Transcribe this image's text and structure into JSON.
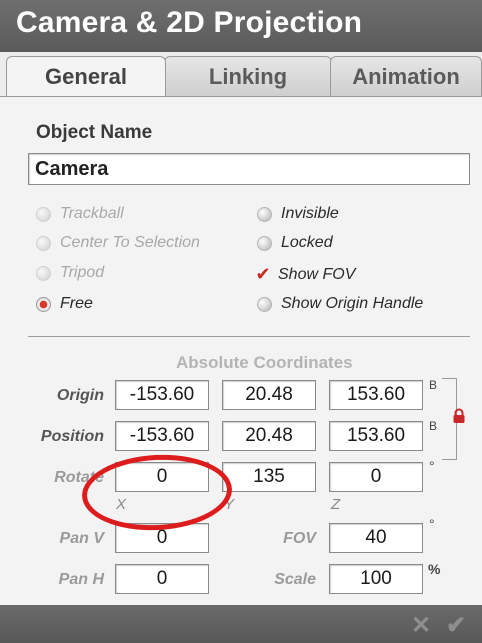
{
  "window": {
    "title": "Camera & 2D Projection"
  },
  "tabs": [
    {
      "label": "General",
      "active": true
    },
    {
      "label": "Linking",
      "active": false
    },
    {
      "label": "Animation",
      "active": false
    }
  ],
  "object_name": {
    "label": "Object Name",
    "value": "Camera"
  },
  "options": {
    "camera_modes": [
      {
        "label": "Trackball",
        "selected": false,
        "enabled": false
      },
      {
        "label": "Center To Selection",
        "selected": false,
        "enabled": false
      },
      {
        "label": "Tripod",
        "selected": false,
        "enabled": false
      },
      {
        "label": "Free",
        "selected": true,
        "enabled": true
      }
    ],
    "flags": [
      {
        "label": "Invisible",
        "checked": false
      },
      {
        "label": "Locked",
        "checked": false
      },
      {
        "label": "Show FOV",
        "checked": true
      },
      {
        "label": "Show Origin Handle",
        "checked": false
      }
    ]
  },
  "coordinates": {
    "title": "Absolute Coordinates",
    "origin": {
      "label": "Origin",
      "x": "-153.60",
      "y": "20.48",
      "z": "153.60",
      "unit": "B"
    },
    "position": {
      "label": "Position",
      "x": "-153.60",
      "y": "20.48",
      "z": "153.60",
      "unit": "B"
    },
    "rotate": {
      "label": "Rotate",
      "x": "0",
      "y": "135",
      "z": "0",
      "unit": "°"
    },
    "axis_labels": {
      "x": "X",
      "y": "Y",
      "z": "Z"
    },
    "pan_v": {
      "label": "Pan V",
      "value": "0"
    },
    "pan_h": {
      "label": "Pan H",
      "value": "0"
    },
    "fov": {
      "label": "FOV",
      "value": "40",
      "unit": "°"
    },
    "scale": {
      "label": "Scale",
      "value": "100",
      "unit": "%"
    }
  },
  "footer": {
    "cancel_glyph": "✕",
    "ok_glyph": "✔"
  },
  "colors": {
    "accent": "#d63a2a",
    "titlebar": "#636363",
    "annotation": "#dd1d1d"
  }
}
